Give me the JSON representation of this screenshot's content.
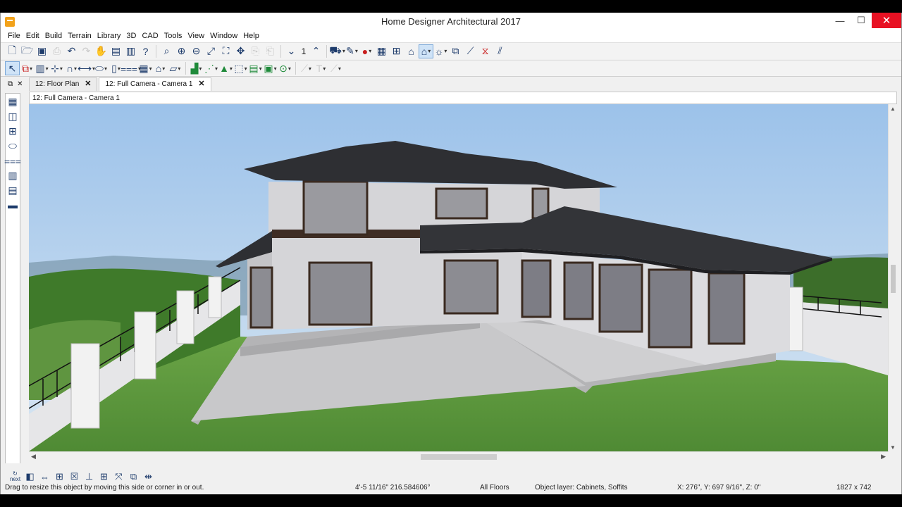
{
  "window": {
    "title": "Home Designer Architectural 2017",
    "controls": {
      "minimize": "—",
      "maximize": "☐",
      "close": "✕"
    }
  },
  "menu": [
    "File",
    "Edit",
    "Build",
    "Terrain",
    "Library",
    "3D",
    "CAD",
    "Tools",
    "View",
    "Window",
    "Help"
  ],
  "toolbar1": {
    "icons": [
      "new-plan-icon",
      "open-icon",
      "save-icon",
      "print-icon",
      "undo-icon",
      "redo-icon",
      "select-hand-icon",
      "library-icon",
      "parts-icon",
      "help-icon",
      "zoom-icon",
      "zoom-in-icon",
      "zoom-out-icon",
      "fill-window-icon",
      "fit-icon",
      "pan-icon",
      "copy-icon",
      "paste-icon",
      "floor-down-icon",
      "floor-up-icon",
      "camera-icon",
      "tape-icon",
      "record-icon",
      "render-icon",
      "elevation-icon",
      "roof-icon",
      "house-camera-icon",
      "sun-icon",
      "transform-icon",
      "eyedropper-icon",
      "material-icon",
      "paint-icon"
    ],
    "floor_number": "1"
  },
  "tabs": [
    {
      "label": "12: Floor Plan",
      "close": "✕"
    },
    {
      "label": "12: Full Camera - Camera 1",
      "close": "✕"
    }
  ],
  "view": {
    "title": "12: Full Camera - Camera 1"
  },
  "colors": {
    "sky_top": "#9cc2ea",
    "sky_bottom": "#d8e6f2",
    "wall": "#d3d3d6",
    "roof": "#2e2f33",
    "lawn": "#5e9a3c",
    "patio": "#c4c4c6",
    "close_button": "#e81123"
  },
  "bottom_tools": {
    "next_label": "next"
  },
  "status": {
    "hint": "Drag to resize this object by moving this side or corner in or out.",
    "measurement": "4'-5 11/16\" 216.584606°",
    "floors": "All Floors",
    "layer": "Object layer: Cabinets,  Soffits",
    "coords": "X: 276\", Y: 697 9/16\", Z: 0\"",
    "size": "1827 x 742"
  }
}
